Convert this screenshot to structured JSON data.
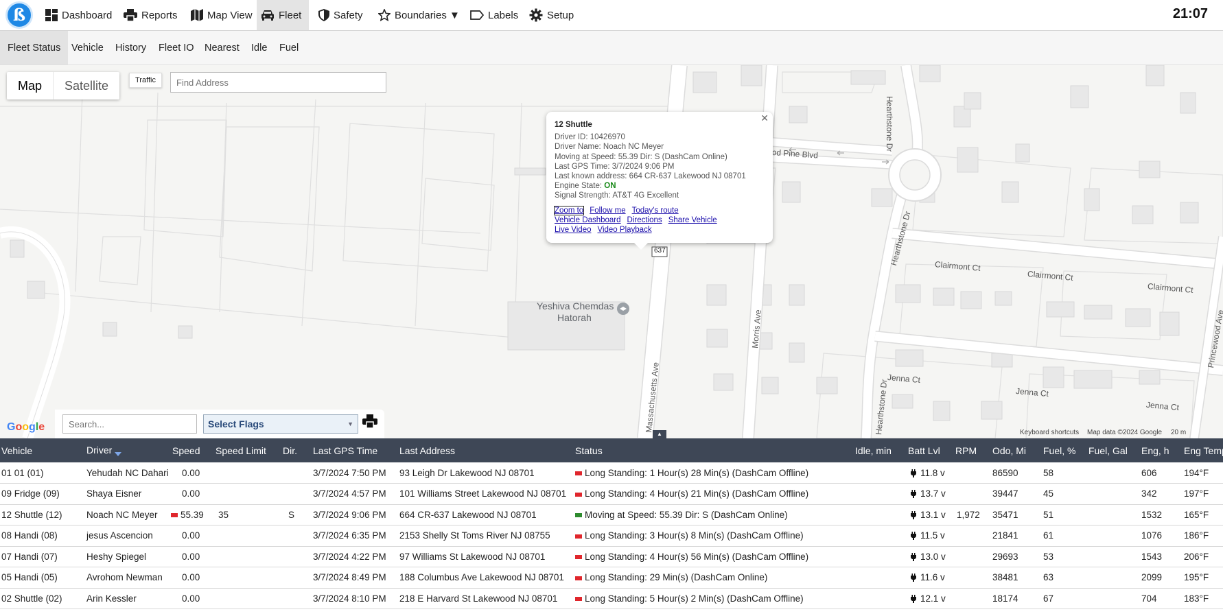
{
  "nav": {
    "items": [
      {
        "label": "Dashboard",
        "icon": "dashboard-icon"
      },
      {
        "label": "Reports",
        "icon": "printer-icon"
      },
      {
        "label": "Map View",
        "icon": "map-icon"
      },
      {
        "label": "Fleet",
        "icon": "car-icon",
        "active": true
      },
      {
        "label": "Safety",
        "icon": "shield-icon"
      },
      {
        "label": "Boundaries ▼",
        "icon": "star-icon"
      },
      {
        "label": "Labels",
        "icon": "label-icon"
      },
      {
        "label": "Setup",
        "icon": "gear-icon"
      }
    ],
    "clock": "21:07"
  },
  "subnav": {
    "items": [
      "Fleet Status",
      "Vehicle",
      "History",
      "Fleet IO",
      "Nearest",
      "Idle",
      "Fuel"
    ],
    "active": "Fleet Status"
  },
  "map": {
    "type_map": "Map",
    "type_satellite": "Satellite",
    "traffic": "Traffic",
    "find_placeholder": "Find Address",
    "labels": {
      "hearthstone_top": "Hearthstone Dr",
      "hearthstone_mid": "Hearthstone Dr",
      "hearthstone_bottom": "Hearthstone Dr",
      "pine_blvd": "ood Pine Blvd",
      "clairmont1": "Clairmont Ct",
      "clairmont2": "Clairmont Ct",
      "clairmont3": "Clairmont Ct",
      "jenna1": "Jenna Ct",
      "jenna2": "Jenna Ct",
      "jenna3": "Jenna Ct",
      "princewood": "Princewood Ave",
      "morris": "Morris Ave",
      "massachusetts": "Massachusetts Ave",
      "route": "637",
      "yeshiva1": "Yeshiva Chemdas",
      "yeshiva2": "Hatorah"
    },
    "google": "Google",
    "shortcuts": "Keyboard shortcuts",
    "map_data": "Map data ©2024 Google",
    "scale": "20 m"
  },
  "infowindow": {
    "title": "12 Shuttle",
    "driver_id": "Driver ID: 10426970",
    "driver_name": "Driver Name: Noach NC Meyer",
    "moving": "Moving at Speed: 55.39 Dir: S (DashCam Online)",
    "last_gps": "Last GPS Time: 3/7/2024 9:06 PM",
    "address": "Last known address: 664 CR-637 Lakewood NJ 08701",
    "engine_label": "Engine State:",
    "engine_value": "ON",
    "signal": "Signal Strength: AT&T 4G Excellent",
    "links": [
      "Zoom to",
      "Follow me",
      "Today's route",
      "Vehicle Dashboard",
      "Directions",
      "Share Vehicle",
      "Live Video",
      "Video Playback"
    ]
  },
  "controls": {
    "search_placeholder": "Search...",
    "flags": "Select Flags"
  },
  "table": {
    "columns": [
      "Vehicle",
      "Driver",
      "Speed",
      "Speed Limit",
      "Dir.",
      "Last GPS Time",
      "Last Address",
      "Status",
      "Idle, min",
      "Batt Lvl",
      "RPM",
      "Odo, Mi",
      "Fuel, %",
      "Fuel, Gal",
      "Eng, h",
      "Eng Temp"
    ],
    "status_colors": {
      "red": "#e0262c",
      "green": "#2e8b2e"
    },
    "rows": [
      {
        "vehicle": "01 01 (01)",
        "driver": "Yehudah NC Dahari",
        "speed": "0.00",
        "speed_flag": "",
        "limit": "",
        "dir": "",
        "gps": "3/7/2024 7:50 PM",
        "address": "93 Leigh Dr Lakewood NJ 08701",
        "status_color": "red",
        "status": "Long Standing: 1 Hour(s) 28 Min(s) (DashCam Offline)",
        "idle": "",
        "batt": "11.8 v",
        "rpm": "",
        "odo": "86590",
        "fuel_pct": "58",
        "fuel_gal": "",
        "eng_h": "606",
        "eng_temp": "194°F"
      },
      {
        "vehicle": "09 Fridge (09)",
        "driver": "Shaya Eisner",
        "speed": "0.00",
        "speed_flag": "",
        "limit": "",
        "dir": "",
        "gps": "3/7/2024 4:57 PM",
        "address": "101 Williams Street Lakewood NJ 08701",
        "status_color": "red",
        "status": "Long Standing: 4 Hour(s) 21 Min(s) (DashCam Offline)",
        "idle": "",
        "batt": "13.7 v",
        "rpm": "",
        "odo": "39447",
        "fuel_pct": "45",
        "fuel_gal": "",
        "eng_h": "342",
        "eng_temp": "197°F"
      },
      {
        "vehicle": "12 Shuttle (12)",
        "driver": "Noach NC Meyer",
        "speed": "55.39",
        "speed_flag": "red",
        "limit": "35",
        "dir": "S",
        "gps": "3/7/2024 9:06 PM",
        "address": "664 CR-637 Lakewood NJ 08701",
        "status_color": "green",
        "status": "Moving at Speed: 55.39 Dir: S (DashCam Online)",
        "idle": "",
        "batt": "13.1 v",
        "rpm": "1,972",
        "odo": "35471",
        "fuel_pct": "51",
        "fuel_gal": "",
        "eng_h": "1532",
        "eng_temp": "165°F"
      },
      {
        "vehicle": "08 Handi (08)",
        "driver": "jesus Ascencion",
        "speed": "0.00",
        "speed_flag": "",
        "limit": "",
        "dir": "",
        "gps": "3/7/2024 6:35 PM",
        "address": "2153 Shelly St Toms River NJ 08755",
        "status_color": "red",
        "status": "Long Standing: 3 Hour(s) 8 Min(s) (DashCam Offline)",
        "idle": "",
        "batt": "11.5 v",
        "rpm": "",
        "odo": "21841",
        "fuel_pct": "61",
        "fuel_gal": "",
        "eng_h": "1076",
        "eng_temp": "186°F"
      },
      {
        "vehicle": "07 Handi (07)",
        "driver": "Heshy Spiegel",
        "speed": "0.00",
        "speed_flag": "",
        "limit": "",
        "dir": "",
        "gps": "3/7/2024 4:22 PM",
        "address": "97 Williams St Lakewood NJ 08701",
        "status_color": "red",
        "status": "Long Standing: 4 Hour(s) 56 Min(s) (DashCam Offline)",
        "idle": "",
        "batt": "13.0 v",
        "rpm": "",
        "odo": "29693",
        "fuel_pct": "53",
        "fuel_gal": "",
        "eng_h": "1543",
        "eng_temp": "206°F"
      },
      {
        "vehicle": "05 Handi (05)",
        "driver": "Avrohom Newman",
        "speed": "0.00",
        "speed_flag": "",
        "limit": "",
        "dir": "",
        "gps": "3/7/2024 8:49 PM",
        "address": "188 Columbus Ave Lakewood NJ 08701",
        "status_color": "red",
        "status": "Long Standing: 29 Min(s) (DashCam Online)",
        "idle": "",
        "batt": "11.6 v",
        "rpm": "",
        "odo": "38481",
        "fuel_pct": "63",
        "fuel_gal": "",
        "eng_h": "2099",
        "eng_temp": "195°F"
      },
      {
        "vehicle": "02 Shuttle (02)",
        "driver": "Arin Kessler",
        "speed": "0.00",
        "speed_flag": "",
        "limit": "",
        "dir": "",
        "gps": "3/7/2024 8:10 PM",
        "address": "218 E Harvard St Lakewood NJ 08701",
        "status_color": "red",
        "status": "Long Standing: 5 Hour(s) 2 Min(s) (DashCam Offline)",
        "idle": "",
        "batt": "12.1 v",
        "rpm": "",
        "odo": "18174",
        "fuel_pct": "67",
        "fuel_gal": "",
        "eng_h": "704",
        "eng_temp": "183°F"
      }
    ]
  }
}
